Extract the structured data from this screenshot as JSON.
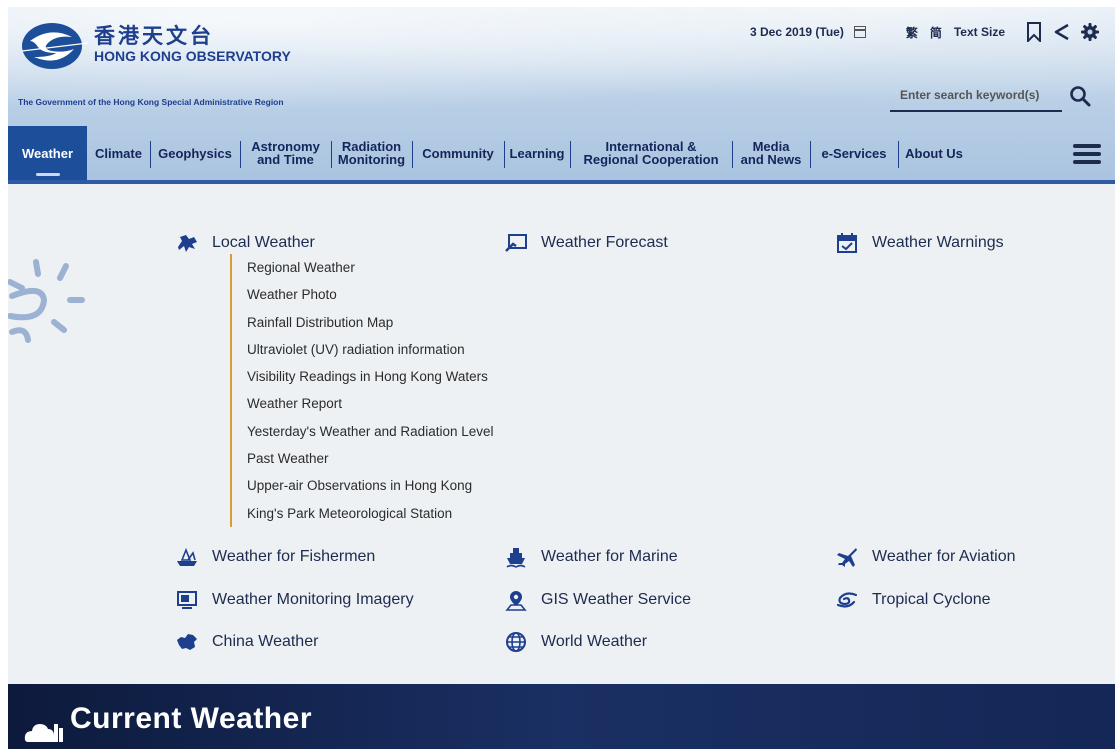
{
  "header": {
    "logo_cn": "香港天文台",
    "logo_en": "HONG KONG OBSERVATORY",
    "gov": "The Government of the Hong Kong Special Administrative Region",
    "date": "3 Dec 2019 (Tue)",
    "lang_tc": "繁",
    "lang_sc": "简",
    "text_size": "Text Size"
  },
  "search": {
    "placeholder": "Enter search keyword(s)"
  },
  "nav": {
    "items": [
      {
        "line1": "Weather",
        "line2": ""
      },
      {
        "line1": "Climate",
        "line2": ""
      },
      {
        "line1": "Geophysics",
        "line2": ""
      },
      {
        "line1": "Astronomy",
        "line2": "and Time"
      },
      {
        "line1": "Radiation",
        "line2": "Monitoring"
      },
      {
        "line1": "Community",
        "line2": ""
      },
      {
        "line1": "Learning",
        "line2": ""
      },
      {
        "line1": "International &",
        "line2": "Regional Cooperation"
      },
      {
        "line1": "Media",
        "line2": "and News"
      },
      {
        "line1": "e-Services",
        "line2": ""
      },
      {
        "line1": "About Us",
        "line2": ""
      }
    ]
  },
  "menu": {
    "local_weather": "Local Weather",
    "weather_forecast": "Weather Forecast",
    "weather_warnings": "Weather Warnings",
    "sub_items": [
      "Regional Weather",
      "Weather Photo",
      "Rainfall Distribution Map",
      "Ultraviolet (UV) radiation information",
      "Visibility Readings in Hong Kong Waters",
      "Weather Report",
      "Yesterday's Weather and Radiation Level",
      "Past Weather",
      "Upper-air Observations in Hong Kong",
      "King's Park Meteorological Station"
    ],
    "fishermen": "Weather for Fishermen",
    "marine": "Weather for Marine",
    "aviation": "Weather for Aviation",
    "monitoring": "Weather Monitoring Imagery",
    "gis": "GIS Weather Service",
    "cyclone": "Tropical Cyclone",
    "china": "China Weather",
    "world": "World Weather"
  },
  "banner": {
    "title": "Current Weather"
  },
  "colors": {
    "brand": "#1d3f8e",
    "active_nav": "#1d4e9a",
    "submenu_rule": "#d89a3a",
    "banner": "#142756"
  }
}
